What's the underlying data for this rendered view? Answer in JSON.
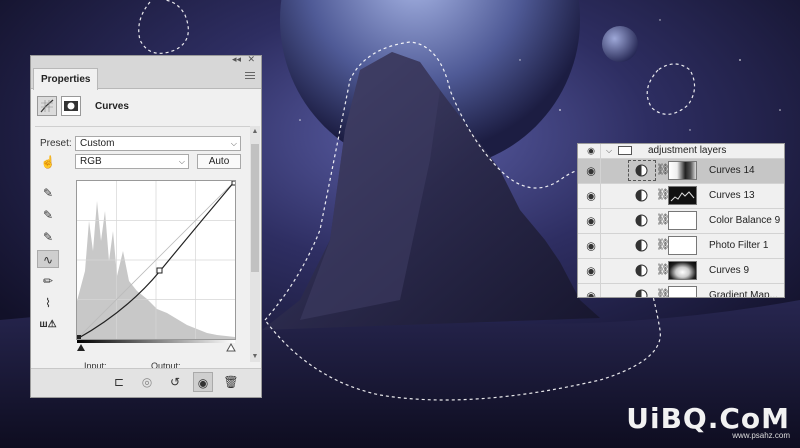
{
  "properties": {
    "tab": "Properties",
    "adjustment_title": "Curves",
    "preset_label": "Preset:",
    "preset_value": "Custom",
    "channel_value": "RGB",
    "auto_label": "Auto",
    "input_label": "Input:",
    "output_label": "Output:",
    "icons": {
      "tab_close": "double-close-icon",
      "adjustment": "curves-adjustment-icon",
      "mask": "layer-mask-icon",
      "on_image": "targeted-adjustment-icon",
      "sample_black": "black-eyedropper-icon",
      "sample_gray": "gray-eyedropper-icon",
      "sample_white": "white-eyedropper-icon",
      "edit_points": "curve-points-icon",
      "draw": "pencil-icon",
      "smooth": "smooth-icon",
      "clipping": "clipping-warning-icon",
      "clip_to_layer": "clip-to-layer-icon",
      "view_previous": "view-previous-icon",
      "reset": "reset-icon",
      "visibility": "eye-icon",
      "delete": "trash-icon"
    }
  },
  "layers": {
    "group_name": "adjustment layers",
    "items": [
      {
        "name": "Curves 14",
        "type": "curves",
        "mask": "curves14",
        "selected": true
      },
      {
        "name": "Curves 13",
        "type": "curves",
        "mask": "curves13",
        "selected": false
      },
      {
        "name": "Color Balance 9",
        "type": "balance",
        "mask": "white",
        "selected": false
      },
      {
        "name": "Photo Filter 1",
        "type": "filter",
        "mask": "white",
        "selected": false
      },
      {
        "name": "Curves 9",
        "type": "curves",
        "mask": "curves9",
        "selected": false
      },
      {
        "name": "Gradient Map...",
        "type": "gradient",
        "mask": "white",
        "selected": false
      }
    ]
  },
  "watermark": {
    "main": "UiBQ.CoM",
    "sub": "www.psahz.com"
  },
  "colors": {
    "sky": "#1f1e46",
    "glow": "#5b5fa6",
    "rock": "#2b2a4c",
    "panel": "#f0f0f0",
    "selected_row": "#c6c6c6"
  }
}
